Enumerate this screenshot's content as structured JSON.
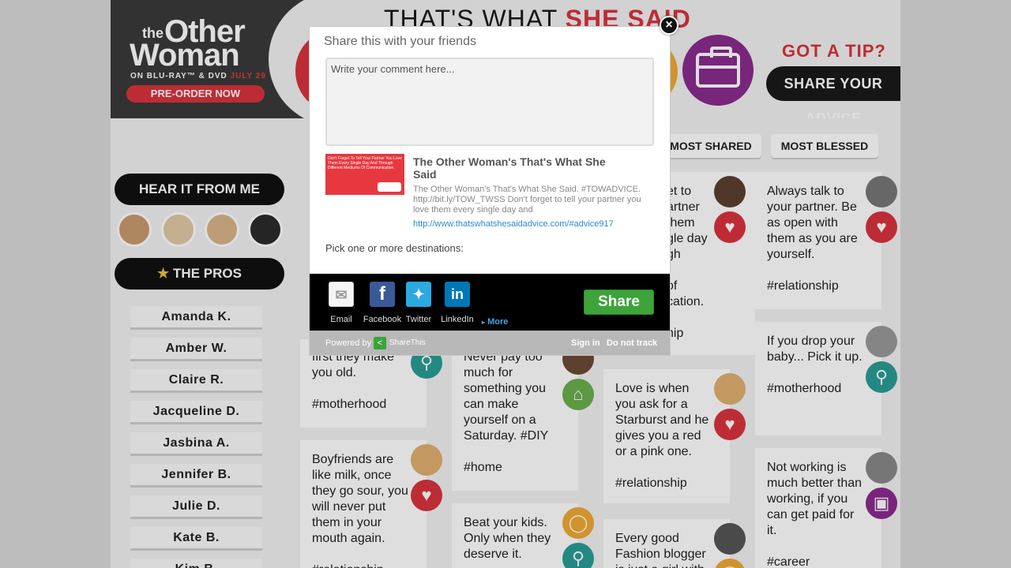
{
  "header": {
    "promo_the": "the",
    "promo_other": "Other",
    "promo_woman": "Woman",
    "promo_release": "ON BLU-RAY™ & DVD",
    "promo_date": "JULY 29",
    "preorder_label": "PRE-ORDER NOW",
    "title_part1": "THAT'S WHAT ",
    "title_part2": "SHE SAID",
    "got_tip": "GOT A TIP?",
    "share_advice_label": "SHARE YOUR ADVICE"
  },
  "tabs": {
    "most_shared": "MOST SHARED",
    "most_blessed": "MOST BLESSED"
  },
  "sidebar": {
    "hear_it_label": "HEAR IT FROM ME",
    "pros_label": "THE PROS",
    "pros": [
      "Amanda K.",
      "Amber W.",
      "Claire R.",
      "Jacqueline D.",
      "Jasbina A.",
      "Jennifer B.",
      "Julie D.",
      "Kate B.",
      "Kim B."
    ]
  },
  "cards": {
    "c1": "et to\nartner\nthem\ngle day\ngh\n\nof\ncation.\n\nhip",
    "c2": "Always talk to\nyour partner. Be\nas open with\nthem as you are\nyourself.\n\n#relationship",
    "c3": "If you drop your\nbaby... Pick it up.\n\n#motherhood",
    "c4": "first they make\nyou old.\n\n#motherhood",
    "c5": "Never pay too\nmuch for\nsomething you\ncan make\nyourself on a\nSaturday. #DIY\n\n#home",
    "c6": "Love is when\nyou ask for a\nStarburst and he\ngives you a red\nor a pink one.\n\n#relationship",
    "c7": "Boyfriends are\nlike milk, once\nthey go sour, you\nwill never put\nthem in your\nmouth again.\n\n#relationship",
    "c8": "Not working is\nmuch better than\nworking, if you\ncan get paid for\nit.\n\n#career",
    "c9": "Beat your kids.\nOnly when they\ndeserve it.",
    "c10": "Every good\nFashion blogger\nis just a girl with"
  },
  "share_dialog": {
    "title": "Share this with your friends",
    "comment_placeholder": "Write your comment here...",
    "thumb_text": "Don't Forget To Tell Your Partner You Love Them Every Single Day And Through Different Mediums Of Communication.",
    "snippet_title": "The Other Woman's That's What She Said",
    "snippet_desc": "The Other Woman's That's What She Said. #TOWADVICE. http://bit.ly/TOW_TWSS Don't forget to tell your partner you love them every single day and",
    "snippet_url": "http://www.thatswhatshesaidadvice.com/#advice917",
    "pick_label": "Pick one or more destinations:",
    "destinations": [
      "Email",
      "Facebook",
      "Twitter",
      "LinkedIn"
    ],
    "more_label": "More",
    "share_label": "Share",
    "powered_by": "Powered by",
    "sharethis_name": "ShareThis",
    "sign_in": "Sign in",
    "do_not_track": "Do not track",
    "close_glyph": "×"
  },
  "colors": {
    "red": "#d9333d",
    "purple": "#8a2b8f",
    "teal": "#2a9d96",
    "green": "#6ab04c",
    "orange": "#f0a935",
    "share_green": "#3da33a"
  }
}
